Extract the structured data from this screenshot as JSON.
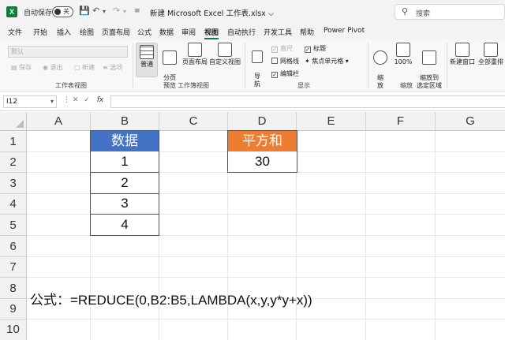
{
  "titlebar": {
    "autosave_label": "自动保存",
    "autosave_state": "关",
    "doc_title": "新建 Microsoft Excel 工作表.xlsx ⌵",
    "search_placeholder": "搜索"
  },
  "menu": {
    "tabs": [
      "文件",
      "开始",
      "插入",
      "绘图",
      "页面布局",
      "公式",
      "数据",
      "审阅",
      "视图",
      "自动执行",
      "开发工具",
      "帮助",
      "Power Pivot"
    ],
    "active_tab": "视图"
  },
  "ribbon": {
    "sheet_view": {
      "select_value": "默认",
      "keep": "保存",
      "exit": "退出",
      "new": "新建",
      "options": "选项",
      "group_label": "工作表视图"
    },
    "workbook_views": {
      "normal": "普通",
      "page_break": "分页\n预览",
      "page_layout": "页面布局",
      "custom": "自定义视图",
      "group_label": "工作簿视图"
    },
    "show": {
      "navigation": "导\n航",
      "ruler": "直尺",
      "gridlines": "网格线",
      "formula_bar": "编辑栏",
      "headings": "标题",
      "focus_cell": "焦点单元格",
      "group_label": "显示"
    },
    "zoom": {
      "zoom": "缩\n放",
      "zoom_100": "100%",
      "zoom_selection": "缩放到\n选定区域",
      "group_label": "缩放"
    },
    "window": {
      "new_window": "新建窗口",
      "arrange_all": "全部重排"
    }
  },
  "formula_bar": {
    "name_box": "I12",
    "cancel": "✕",
    "enter": "✓",
    "fx": "fx",
    "formula": ""
  },
  "sheet": {
    "columns": [
      "A",
      "B",
      "C",
      "D",
      "E",
      "F",
      "G"
    ],
    "rows": [
      "1",
      "2",
      "3",
      "4",
      "5",
      "6",
      "7",
      "8",
      "9",
      "10"
    ],
    "header_colors": {
      "b": "#4472c4",
      "d": "#ed7d31"
    },
    "cells": {
      "B1": "数据",
      "B2": "1",
      "B3": "2",
      "B4": "3",
      "B5": "4",
      "D1": "平方和",
      "D2": "30"
    },
    "note": "公式：=REDUCE(0,B2:B5,LAMBDA(x,y,y*y+x))"
  },
  "icons": [
    "excel-logo-icon",
    "undo-icon",
    "redo-icon",
    "customize-icon",
    "search-icon",
    "zoom-icon",
    "new-window-icon",
    "arrange-icon"
  ]
}
